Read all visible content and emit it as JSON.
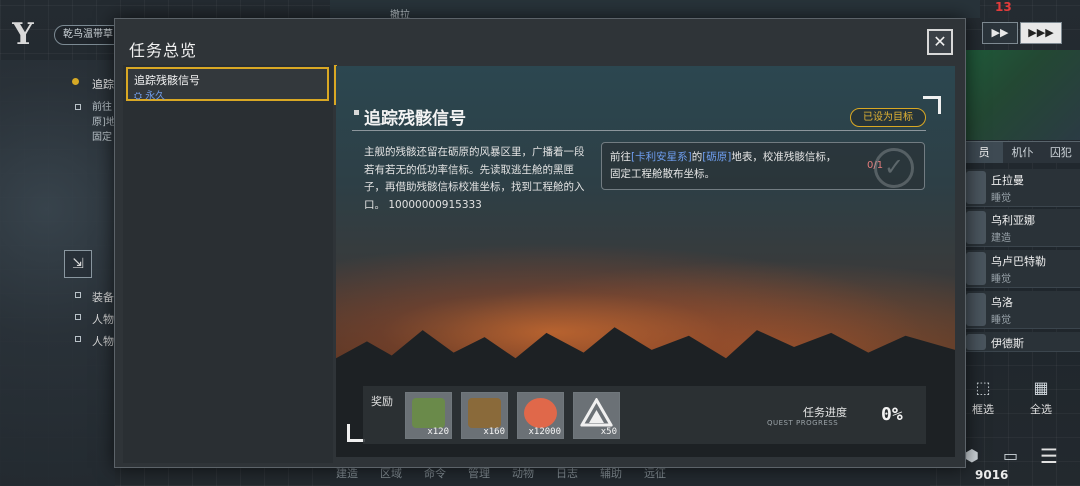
{
  "hud": {
    "location_pill": "乾鸟温带草",
    "tracking_label": "追踪",
    "task_line_1": "前往",
    "task_line_2": "原]地",
    "task_line_3": "固定",
    "left_items": [
      "装备",
      "人物",
      "人物"
    ],
    "speed_counter": "13",
    "speed_btn_1": "▶▶",
    "speed_btn_2": "▶▶▶",
    "right_tabs": [
      "员",
      "机仆",
      "囚犯"
    ],
    "crew": [
      {
        "name": "丘拉曼",
        "status": "睡觉"
      },
      {
        "name": "乌利亚娜",
        "status": "建造"
      },
      {
        "name": "乌卢巴特勒",
        "status": "睡觉"
      },
      {
        "name": "乌洛",
        "status": "睡觉"
      },
      {
        "name": "伊德斯",
        "status": ""
      }
    ],
    "select_frame": "框选",
    "select_all": "全选",
    "bottom_tabs": [
      "建造",
      "区域",
      "命令",
      "管理",
      "动物",
      "日志",
      "辅助",
      "远征"
    ],
    "resource_count": "9016",
    "map_label_top": "撤拉"
  },
  "modal": {
    "title": "任务总览",
    "close_icon": "✕",
    "list": [
      {
        "title": "追踪残骸信号",
        "tag": "永久"
      }
    ]
  },
  "quest": {
    "title": "追踪残骸信号",
    "target_badge": "已设为目标",
    "description": "主舰的残骸还留在砺原的风暴区里，广播着一段若有若无的低功率信标。先读取逃生舱的黑匣子，再借助残骸信标校准坐标，找到工程舱的入口。 10000000915333",
    "objective": {
      "prefix": "前往",
      "hl1": "[卡利安星系]",
      "mid": "的",
      "hl2": "[砺原]",
      "suffix": "地表，校准残骸信标，固定工程舱散布坐标。",
      "count": "0/1"
    },
    "reward_label": "奖励",
    "rewards": [
      {
        "icon": "supply-crate-icon",
        "qty": "x120",
        "color": "#6a8a4a"
      },
      {
        "icon": "ore-chunk-icon",
        "qty": "x160",
        "color": "#8a6a3a"
      },
      {
        "icon": "credit-token-icon",
        "qty": "x12000",
        "color": "#e0684a"
      },
      {
        "icon": "faction-emblem-icon",
        "qty": "x50",
        "color": "#e8e8e8"
      }
    ],
    "progress_label": "任务进度",
    "progress_sub": "QUEST PROGRESS",
    "progress_value": "0%"
  }
}
